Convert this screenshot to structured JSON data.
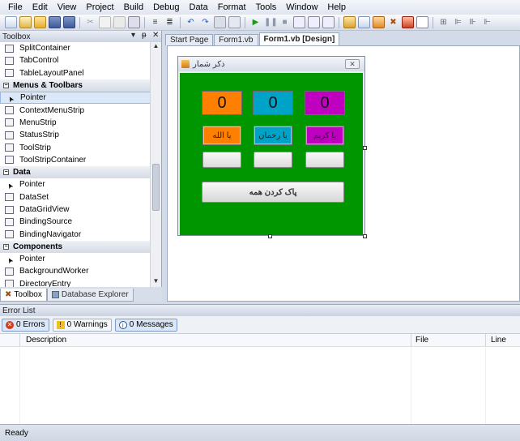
{
  "menu": [
    "File",
    "Edit",
    "View",
    "Project",
    "Build",
    "Debug",
    "Data",
    "Format",
    "Tools",
    "Window",
    "Help"
  ],
  "toolbox": {
    "title": "Toolbox",
    "ctl_dropdown": "▾",
    "ctl_pin": "ᵽ",
    "ctl_close": "✕",
    "items": [
      {
        "type": "item",
        "label": "SplitContainer"
      },
      {
        "type": "item",
        "label": "TabControl"
      },
      {
        "type": "item",
        "label": "TableLayoutPanel"
      },
      {
        "type": "cat",
        "label": "Menus & Toolbars"
      },
      {
        "type": "item",
        "label": "Pointer",
        "selected": true
      },
      {
        "type": "item",
        "label": "ContextMenuStrip"
      },
      {
        "type": "item",
        "label": "MenuStrip"
      },
      {
        "type": "item",
        "label": "StatusStrip"
      },
      {
        "type": "item",
        "label": "ToolStrip"
      },
      {
        "type": "item",
        "label": "ToolStripContainer"
      },
      {
        "type": "cat",
        "label": "Data"
      },
      {
        "type": "item",
        "label": "Pointer"
      },
      {
        "type": "item",
        "label": "DataSet"
      },
      {
        "type": "item",
        "label": "DataGridView"
      },
      {
        "type": "item",
        "label": "BindingSource"
      },
      {
        "type": "item",
        "label": "BindingNavigator"
      },
      {
        "type": "cat",
        "label": "Components"
      },
      {
        "type": "item",
        "label": "Pointer"
      },
      {
        "type": "item",
        "label": "BackgroundWorker"
      },
      {
        "type": "item",
        "label": "DirectoryEntry"
      }
    ],
    "tabs": [
      "Toolbox",
      "Database Explorer"
    ]
  },
  "doc_tabs": [
    {
      "label": "Start Page",
      "active": false
    },
    {
      "label": "Form1.vb",
      "active": false
    },
    {
      "label": "Form1.vb [Design]",
      "active": true
    }
  ],
  "form": {
    "title": "ذکر شمار",
    "close": "✕",
    "counters": [
      {
        "value": "0",
        "color": "#ff8000"
      },
      {
        "value": "0",
        "color": "#00a3c8"
      },
      {
        "value": "0",
        "color": "#c000c0"
      }
    ],
    "tasbih_buttons": [
      {
        "label": "یا الله",
        "color": "#ff8000"
      },
      {
        "label": "یا رحمان",
        "color": "#00a3c8"
      },
      {
        "label": "یا کریم",
        "color": "#c000c0"
      }
    ],
    "reset_label": "پاک کردن همه",
    "back_color": "#009600"
  },
  "error_list": {
    "title": "Error List",
    "filters": [
      "0 Errors",
      "0 Warnings",
      "0 Messages"
    ],
    "columns": [
      "Description",
      "File",
      "Line"
    ]
  },
  "status": "Ready"
}
